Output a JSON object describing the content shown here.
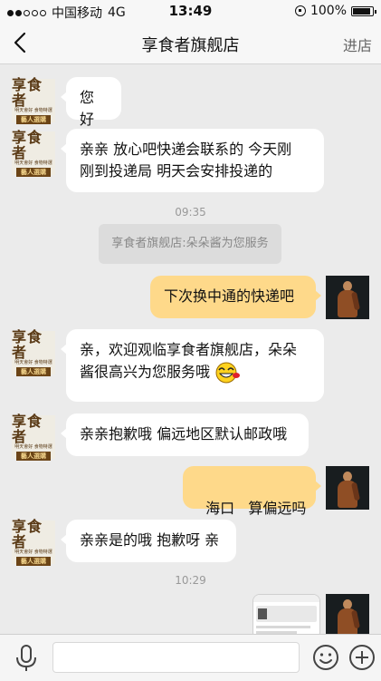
{
  "status_bar": {
    "carrier": "中国移动",
    "network": "4G",
    "time": "13:49",
    "battery": "100%",
    "battery_level": 1.0,
    "signal_bars_filled": 2,
    "signal_bars_total": 5
  },
  "nav": {
    "back_icon": "chevron-left-icon",
    "title": "享食者旗舰店",
    "store_button": "进店"
  },
  "store_logo": {
    "line1": "享食者",
    "line2": "明天會好  食物特選",
    "line3": "藝人選購"
  },
  "messages": [
    {
      "from": "store",
      "text": "您好"
    },
    {
      "from": "store",
      "text_line1": "亲亲 放心吧快递会联系的 今天刚",
      "text_line2": "刚到投递局 明天会安排投递的"
    },
    {
      "type": "timestamp",
      "text": "09:35"
    },
    {
      "type": "system",
      "text": "享食者旗舰店:朵朵酱为您服务"
    },
    {
      "from": "user",
      "text": "下次换中通的快递吧"
    },
    {
      "from": "store",
      "text_line1": "亲，欢迎观临享食者旗舰店，朵朵",
      "text_line2": "酱很高兴为您服务哦",
      "emoji": "grinning-face-icon"
    },
    {
      "from": "store",
      "text": "亲亲抱歉哦 偏远地区默认邮政哦"
    },
    {
      "from": "user",
      "text": "海口   算偏远吗"
    },
    {
      "from": "store",
      "text": "亲亲是的哦 抱歉呀 亲"
    },
    {
      "type": "timestamp",
      "text": "10:29"
    },
    {
      "from": "user",
      "type": "image",
      "icon": "screenshot-thumbnail-icon"
    }
  ],
  "input_bar": {
    "voice_icon": "microphone-icon",
    "emoji_icon": "smile-icon",
    "more_icon": "plus-circle-icon",
    "placeholder": ""
  },
  "colors": {
    "background": "#ebebeb",
    "incoming_bubble": "#ffffff",
    "outgoing_bubble": "#fed98a",
    "logo_brown": "#6b4416"
  }
}
